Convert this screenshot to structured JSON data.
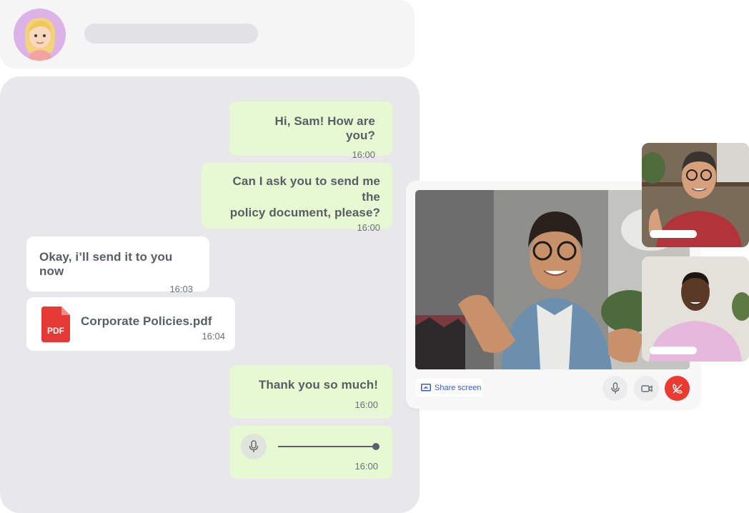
{
  "header": {
    "avatar_icon": "woman-avatar-icon"
  },
  "messages": [
    {
      "direction": "out",
      "text": "Hi, Sam! How are you?",
      "time": "16:00"
    },
    {
      "direction": "out",
      "text_line1": "Can I ask you to send me the",
      "text_line2": "policy document, please?",
      "time": "16:00"
    },
    {
      "direction": "in",
      "text": "Okay, i’ll send it to you now",
      "time": "16:03"
    },
    {
      "direction": "in",
      "type": "file",
      "file_name": "Corporate Policies.pdf",
      "file_badge": "PDF",
      "time": "16:04"
    },
    {
      "direction": "out",
      "text": "Thank you so much!",
      "time": "16:00"
    },
    {
      "direction": "out",
      "type": "voice",
      "progress": 1.0,
      "time": "16:00"
    }
  ],
  "call": {
    "share_label": "Share screen",
    "controls": [
      "microphone-icon",
      "camera-icon",
      "end-call-icon"
    ],
    "colors": {
      "end_call": "#ea3a31",
      "outgoing_bubble": "#e6f9d2",
      "share_text": "#3b5bbf"
    }
  }
}
